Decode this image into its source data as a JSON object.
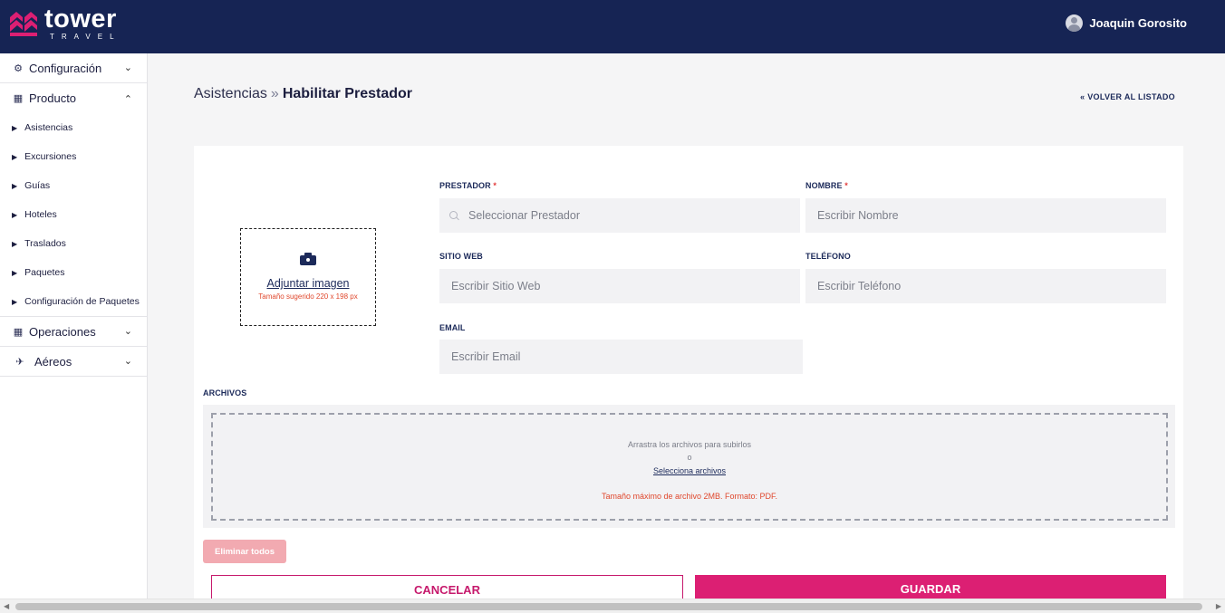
{
  "header": {
    "logo_word": "tower",
    "logo_sub": "TRAVEL",
    "brand_color": "#dc1f73",
    "nav_color": "#162454",
    "user_name": "Joaquin Gorosito"
  },
  "sidebar": {
    "groups": [
      {
        "label": "Configuración",
        "icon": "gear-icon",
        "expanded": false
      },
      {
        "label": "Producto",
        "icon": "building-icon",
        "expanded": true,
        "items": [
          "Asistencias",
          "Excursiones",
          "Guías",
          "Hoteles",
          "Traslados",
          "Paquetes",
          "Configuración de Paquetes"
        ]
      },
      {
        "label": "Operaciones",
        "icon": "building-icon",
        "expanded": false
      },
      {
        "label": "Aéreos",
        "icon": "plane-icon",
        "expanded": false
      }
    ]
  },
  "breadcrumb": {
    "parent": "Asistencias",
    "separator": "»",
    "current": "Habilitar Prestador"
  },
  "back_link": "« VOLVER AL LISTADO",
  "image_upload": {
    "link": "Adjuntar imagen",
    "hint": "Tamaño sugerido 220 x 198 px"
  },
  "form": {
    "prestador": {
      "label": "PRESTADOR",
      "required_mark": "*",
      "placeholder": "Seleccionar Prestador"
    },
    "nombre": {
      "label": "NOMBRE",
      "required_mark": "*",
      "placeholder": "Escribir Nombre"
    },
    "sitio_web": {
      "label": "SITIO WEB",
      "placeholder": "Escribir Sitio Web"
    },
    "telefono": {
      "label": "TELÉFONO",
      "placeholder": "Escribir Teléfono"
    },
    "email": {
      "label": "EMAIL",
      "placeholder": "Escribir Email"
    }
  },
  "archivos": {
    "label": "ARCHIVOS",
    "drag_text": "Arrastra los archivos para subirlos",
    "or_text": "o",
    "select_link": "Selecciona archivos",
    "hint": "Tamaño máximo de archivo 2MB. Formato: PDF."
  },
  "buttons": {
    "delete_all": "Eliminar todos",
    "cancel": "CANCELAR",
    "save": "GUARDAR"
  }
}
